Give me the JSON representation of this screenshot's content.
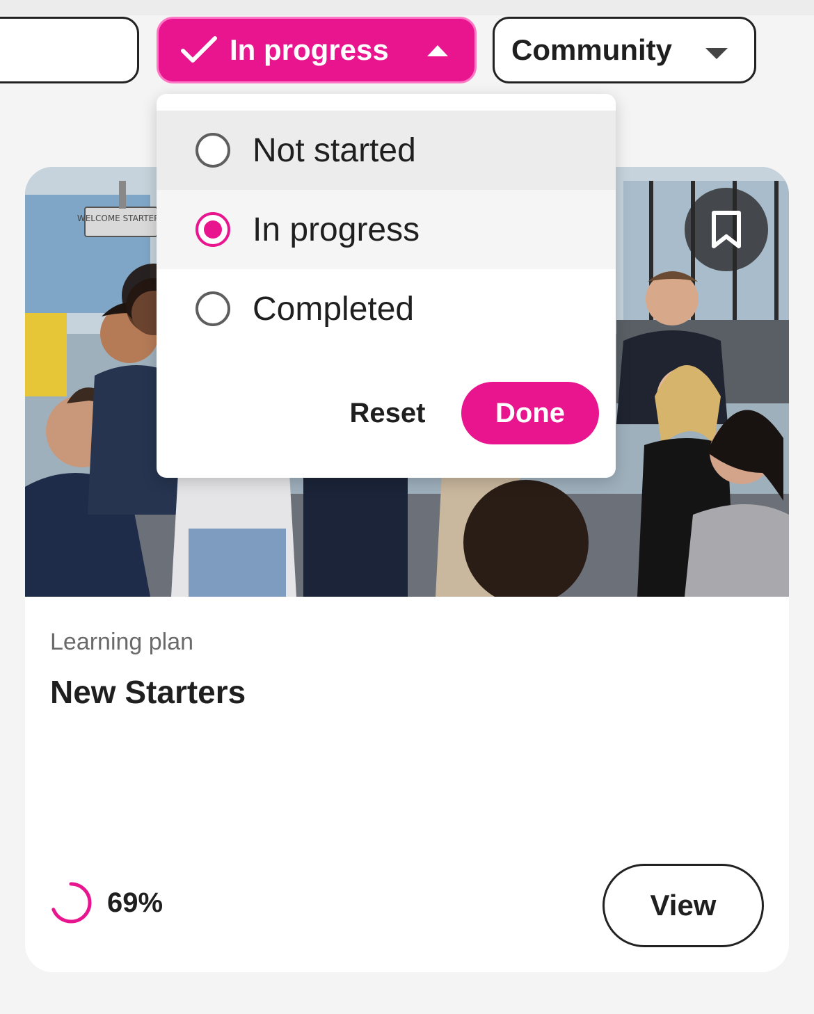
{
  "colors": {
    "accent": "#e8158f",
    "text": "#1f1f1f",
    "muted": "#6a6a6a",
    "background": "#f4f4f4"
  },
  "filters": {
    "status_chip": {
      "label": "In progress",
      "icon": "check-icon",
      "state": "expanded"
    },
    "community_chip": {
      "label": "Community",
      "icon": "chevron-down-icon"
    }
  },
  "status_dropdown": {
    "options": [
      {
        "label": "Not started",
        "selected": false
      },
      {
        "label": "In progress",
        "selected": true
      },
      {
        "label": "Completed",
        "selected": false
      }
    ],
    "reset_label": "Reset",
    "done_label": "Done"
  },
  "card": {
    "image_sign": "WELCOME STARTERS",
    "bookmark_icon": "bookmark-icon",
    "type_label": "Learning plan",
    "title": "New Starters",
    "progress_percent": 69,
    "progress_label": "69%",
    "view_label": "View"
  }
}
